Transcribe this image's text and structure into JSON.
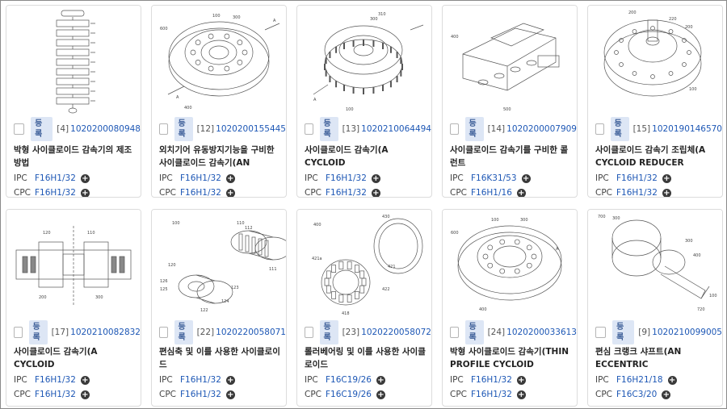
{
  "cards": [
    {
      "badge": "등록",
      "index": "[4]",
      "app_no": "1020200080948",
      "title": "박형 사이클로이드 감속기의 제조방법\n(MANUFACTURING METHOD F…",
      "ipc_label": "IPC",
      "ipc": "F16H1/32",
      "cpc_label": "CPC",
      "cpc": "F16H1/32"
    },
    {
      "badge": "등록",
      "index": "[12]",
      "app_no": "1020200155445",
      "title": "외치기어 유동방지기능을 구비한\n사이클로이드 감속기(AN CYCLOID…",
      "ipc_label": "IPC",
      "ipc": "F16H1/32",
      "cpc_label": "CPC",
      "cpc": "F16H1/32"
    },
    {
      "badge": "등록",
      "index": "[13]",
      "app_no": "1020210064494",
      "title": "사이클로이드 감속기(A CYCLOID\nREDUCER)",
      "ipc_label": "IPC",
      "ipc": "F16H1/32",
      "cpc_label": "CPC",
      "cpc": "F16H1/32"
    },
    {
      "badge": "등록",
      "index": "[14]",
      "app_no": "1020200007909",
      "title": "사이클로이드 감속기를 구비한 콜런트\n밸브 구동 액추에이터(ACTUATOR…",
      "ipc_label": "IPC",
      "ipc": "F16K31/53",
      "cpc_label": "CPC",
      "cpc": "F16H1/16"
    },
    {
      "badge": "등록",
      "index": "[15]",
      "app_no": "1020190146570",
      "title": "사이클로이드 감속기 조립체(A\nCYCLOID REDUCER ASSEMBLY)",
      "ipc_label": "IPC",
      "ipc": "F16H1/32",
      "cpc_label": "CPC",
      "cpc": "F16H1/32"
    },
    {
      "badge": "등록",
      "index": "[17]",
      "app_no": "1020210082832",
      "title": "사이클로이드 감속기(A CYCLOID\nREDUCER)",
      "ipc_label": "IPC",
      "ipc": "F16H1/32",
      "cpc_label": "CPC",
      "cpc": "F16H1/32"
    },
    {
      "badge": "등록",
      "index": "[22]",
      "app_no": "1020220058071",
      "title": "편심축 및 이를 사용한 사이클로이드\n감속기(AN ECCENTRIC SHAFT…",
      "ipc_label": "IPC",
      "ipc": "F16H1/32",
      "cpc_label": "CPC",
      "cpc": "F16H1/32"
    },
    {
      "badge": "등록",
      "index": "[23]",
      "app_no": "1020220058072",
      "title": "롤러베어링 및 이를 사용한 사이클로이드\n감속기(A ROLLER BEARING AND …",
      "ipc_label": "IPC",
      "ipc": "F16C19/26",
      "cpc_label": "CPC",
      "cpc": "F16C19/26"
    },
    {
      "badge": "등록",
      "index": "[24]",
      "app_no": "1020200033613",
      "title": "박형 사이클로이드 감속기(THIN\nPROFILE CYCLOID REDUCER)",
      "ipc_label": "IPC",
      "ipc": "F16H1/32",
      "cpc_label": "CPC",
      "cpc": "F16H1/32"
    },
    {
      "badge": "등록",
      "index": "[9]",
      "app_no": "1020210099005",
      "title": "편심 크랭크 샤프트(AN ECCENTRIC\nCRANK SHAFT)",
      "ipc_label": "IPC",
      "ipc": "F16H21/18",
      "cpc_label": "CPC",
      "cpc": "F16C3/20"
    }
  ],
  "icons": {
    "expand": "plus-circle-icon",
    "select": "checkbox"
  },
  "colors": {
    "badge_bg": "#dde6f5",
    "badge_text": "#3e5f99",
    "link": "#1d57b5"
  }
}
